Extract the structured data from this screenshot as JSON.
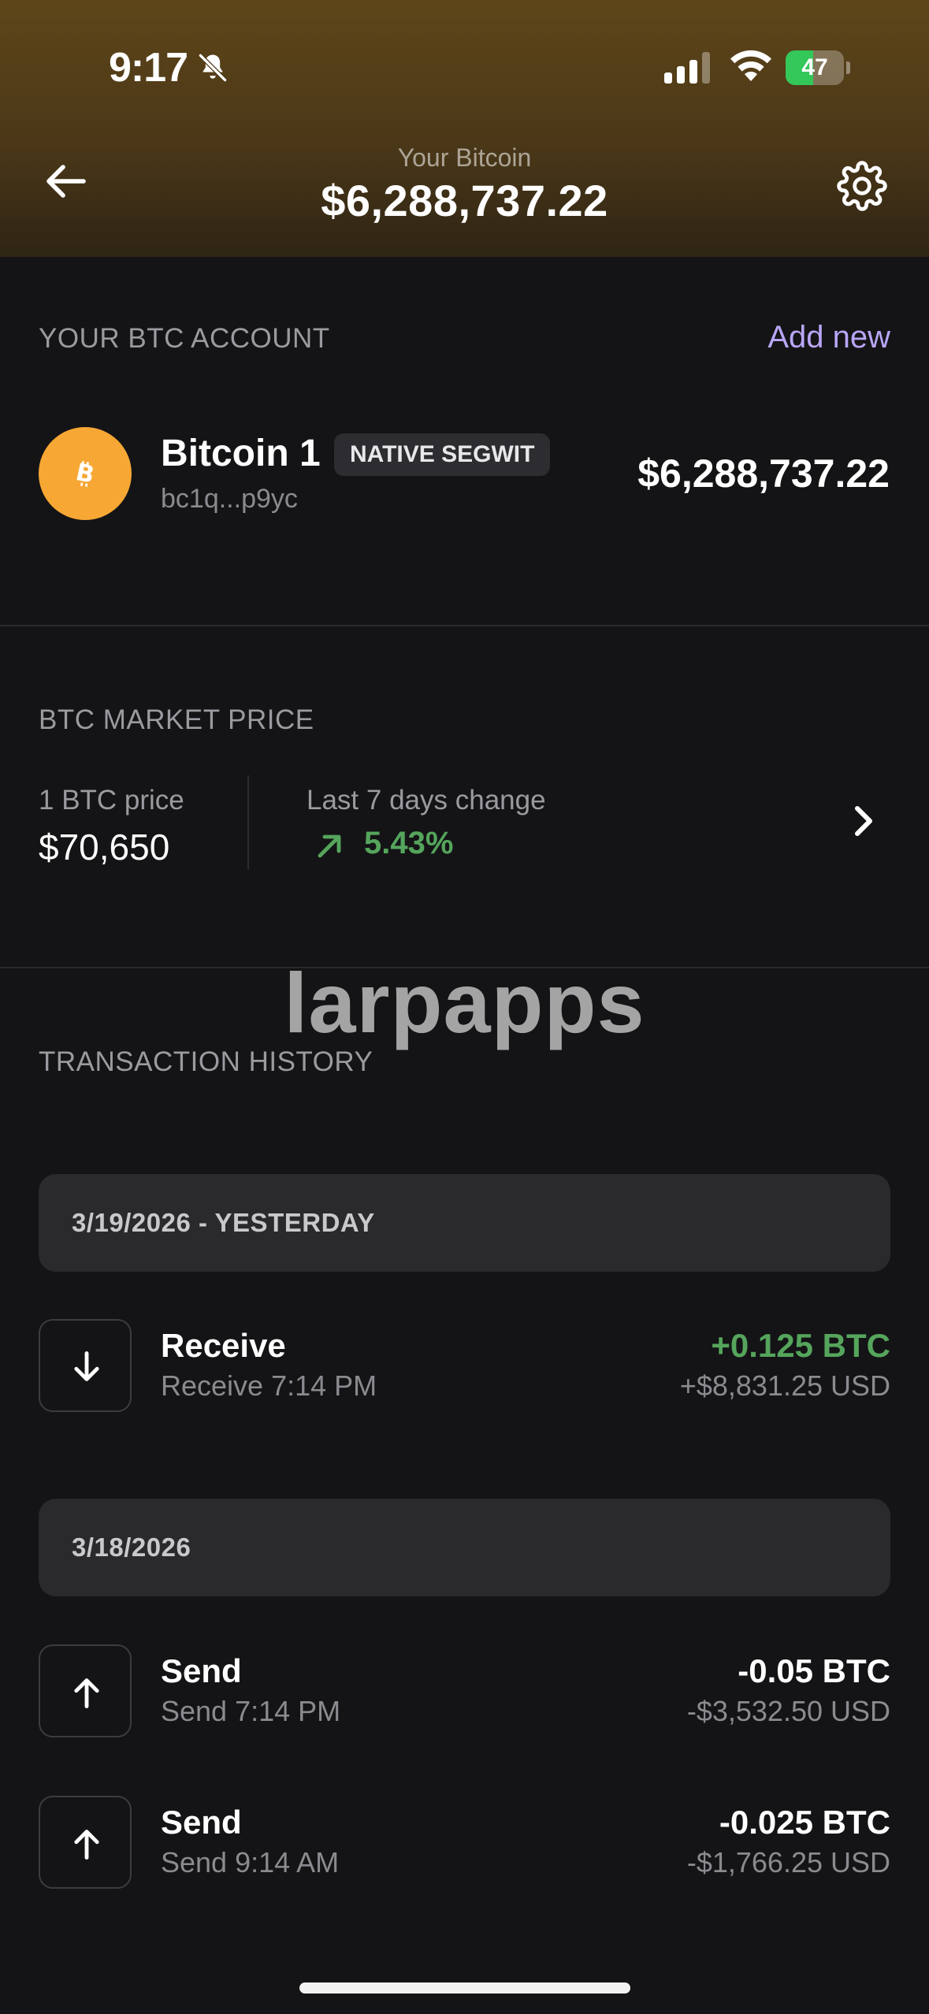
{
  "status_bar": {
    "time": "9:17",
    "battery": "47",
    "battery_level_percent": 47
  },
  "header": {
    "subtitle": "Your Bitcoin",
    "amount": "$6,288,737.22"
  },
  "account_section": {
    "label": "YOUR BTC ACCOUNT",
    "add_new": "Add new",
    "account": {
      "name": "Bitcoin 1",
      "badge": "NATIVE SEGWIT",
      "address": "bc1q...p9yc",
      "balance": "$6,288,737.22",
      "icon": "bitcoin-icon",
      "icon_color": "#f7a734"
    }
  },
  "market_section": {
    "label": "BTC MARKET PRICE",
    "price_label": "1 BTC price",
    "price_value": "$70,650",
    "change_label": "Last 7 days change",
    "change_value": "5.43%",
    "change_color": "#55a55c"
  },
  "watermark": "larpapps",
  "history": {
    "label": "TRANSACTION HISTORY",
    "groups": [
      {
        "date": "3/19/2026 - YESTERDAY",
        "items": [
          {
            "title": "Receive",
            "subtitle": "Receive 7:14 PM",
            "btc": "+0.125 BTC",
            "usd": "+$8,831.25 USD",
            "icon": "arrow-down-icon"
          }
        ]
      },
      {
        "date": "3/18/2026",
        "items": [
          {
            "title": "Send",
            "subtitle": "Send 7:14 PM",
            "btc": "-0.05 BTC",
            "usd": "-$3,532.50 USD",
            "icon": "arrow-up-icon"
          },
          {
            "title": "Send",
            "subtitle": "Send 9:14 AM",
            "btc": "-0.025 BTC",
            "usd": "-$1,766.25 USD",
            "icon": "arrow-up-icon"
          }
        ]
      }
    ]
  },
  "colors": {
    "accent": "#b9a6f7",
    "positive": "#55a55c",
    "background": "#141416"
  }
}
